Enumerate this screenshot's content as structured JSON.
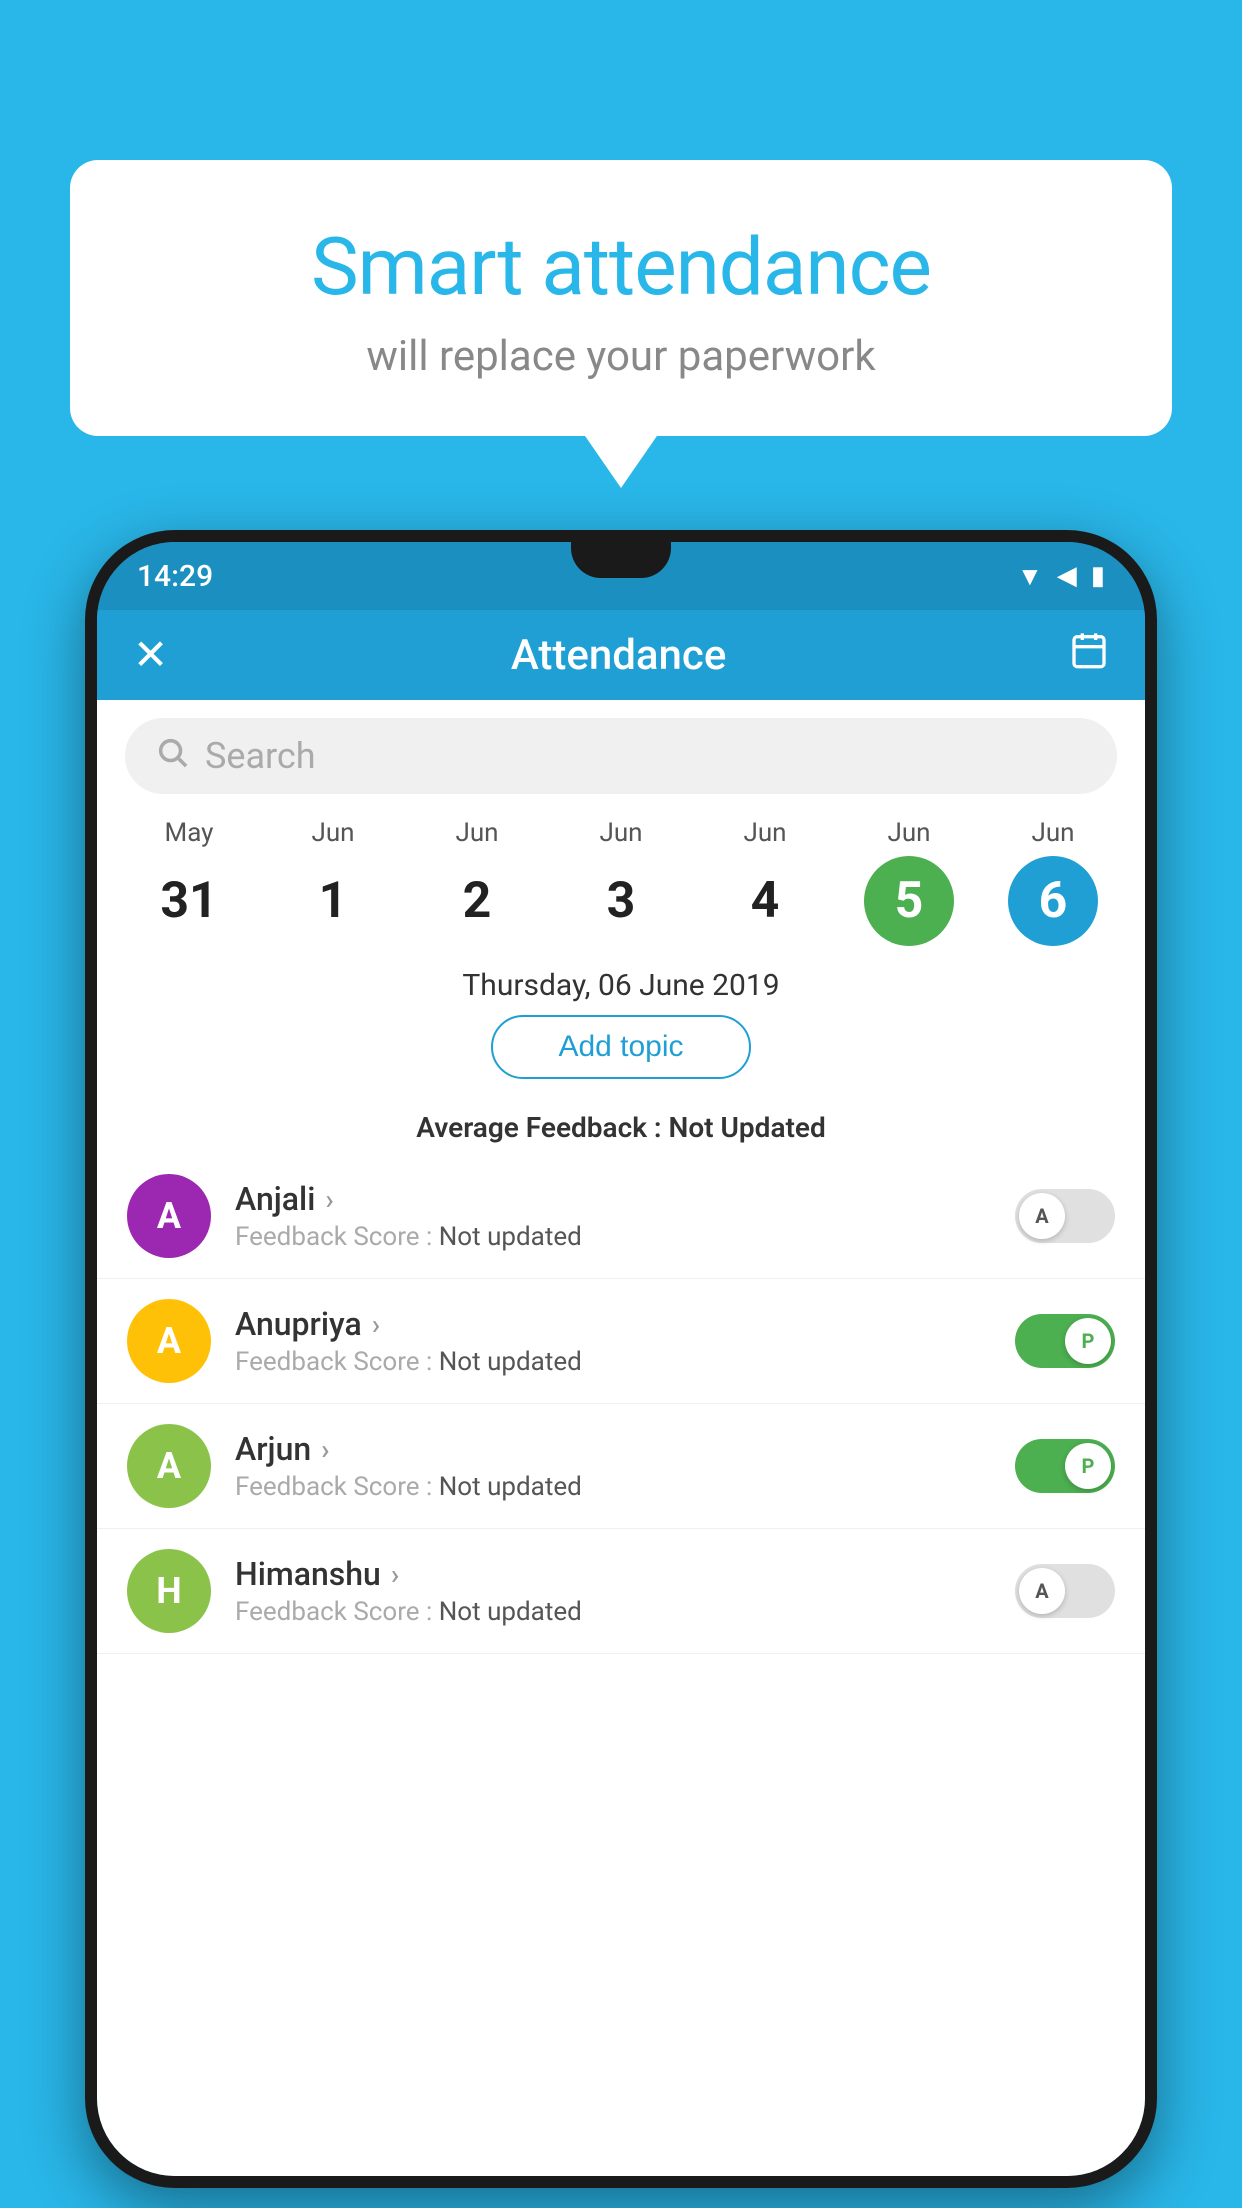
{
  "background_color": "#29b6e8",
  "speech_bubble": {
    "title": "Smart attendance",
    "subtitle": "will replace your paperwork"
  },
  "status_bar": {
    "time": "14:29",
    "wifi_icon": "▼",
    "signal_icon": "▲",
    "battery_icon": "▮"
  },
  "app_bar": {
    "title": "Attendance",
    "close_icon": "✕",
    "calendar_icon": "📅"
  },
  "search": {
    "placeholder": "Search"
  },
  "dates": [
    {
      "month": "May",
      "day": "31",
      "state": "normal"
    },
    {
      "month": "Jun",
      "day": "1",
      "state": "normal"
    },
    {
      "month": "Jun",
      "day": "2",
      "state": "normal"
    },
    {
      "month": "Jun",
      "day": "3",
      "state": "normal"
    },
    {
      "month": "Jun",
      "day": "4",
      "state": "normal"
    },
    {
      "month": "Jun",
      "day": "5",
      "state": "today"
    },
    {
      "month": "Jun",
      "day": "6",
      "state": "selected"
    }
  ],
  "selected_date": "Thursday, 06 June 2019",
  "add_topic_label": "Add topic",
  "avg_feedback_label": "Average Feedback :",
  "avg_feedback_value": "Not Updated",
  "students": [
    {
      "name": "Anjali",
      "avatar_letter": "A",
      "avatar_color": "#9c27b0",
      "feedback_label": "Feedback Score :",
      "feedback_value": "Not updated",
      "toggle_state": "off",
      "toggle_label": "A"
    },
    {
      "name": "Anupriya",
      "avatar_letter": "A",
      "avatar_color": "#ffc107",
      "feedback_label": "Feedback Score :",
      "feedback_value": "Not updated",
      "toggle_state": "on",
      "toggle_label": "P"
    },
    {
      "name": "Arjun",
      "avatar_letter": "A",
      "avatar_color": "#8bc34a",
      "feedback_label": "Feedback Score :",
      "feedback_value": "Not updated",
      "toggle_state": "on",
      "toggle_label": "P"
    },
    {
      "name": "Himanshu",
      "avatar_letter": "H",
      "avatar_color": "#8bc34a",
      "feedback_label": "Feedback Score :",
      "feedback_value": "Not updated",
      "toggle_state": "off",
      "toggle_label": "A"
    }
  ]
}
